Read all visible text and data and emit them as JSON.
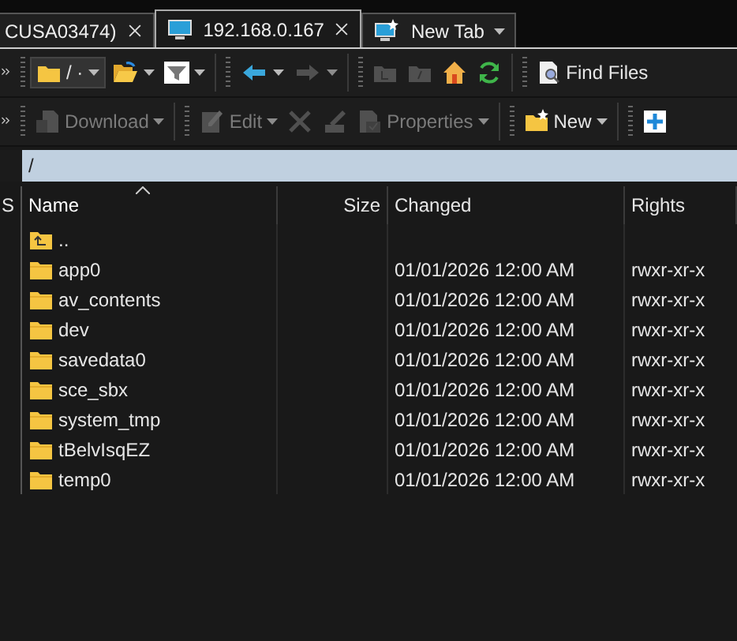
{
  "tabs": [
    {
      "label": "CUSA03474)",
      "kind": "session",
      "selected": false
    },
    {
      "label": "192.168.0.167",
      "kind": "session",
      "selected": true
    },
    {
      "label": "New Tab",
      "kind": "new",
      "selected": false
    }
  ],
  "toolbars": [
    [
      {
        "kind": "combo",
        "label": "/ ·",
        "caret": true,
        "disabled": false
      },
      {
        "kind": "icon",
        "caret": true,
        "disabled": false
      },
      {
        "kind": "icon",
        "caret": true,
        "disabled": false
      },
      {
        "kind": "separator"
      },
      {
        "kind": "icon",
        "caret": true,
        "disabled": false
      },
      {
        "kind": "icon",
        "caret": true,
        "disabled": true
      },
      {
        "kind": "separator"
      },
      {
        "kind": "icon",
        "caret": false,
        "disabled": true
      },
      {
        "kind": "icon",
        "caret": false,
        "disabled": true
      },
      {
        "kind": "icon",
        "caret": false,
        "disabled": false
      },
      {
        "kind": "icon",
        "caret": false,
        "disabled": false
      },
      {
        "kind": "separator"
      },
      {
        "kind": "button",
        "label": "Find Files",
        "caret": false,
        "disabled": false
      }
    ],
    [
      {
        "kind": "button",
        "label": "Download",
        "caret": true,
        "disabled": true
      },
      {
        "kind": "separator"
      },
      {
        "kind": "button",
        "label": "Edit",
        "caret": true,
        "disabled": true
      },
      {
        "kind": "icon",
        "caret": false,
        "disabled": true
      },
      {
        "kind": "icon",
        "caret": false,
        "disabled": true
      },
      {
        "kind": "button",
        "label": "Properties",
        "caret": true,
        "disabled": true
      },
      {
        "kind": "separator"
      },
      {
        "kind": "button",
        "label": "New",
        "caret": true,
        "disabled": false
      },
      {
        "kind": "separator"
      },
      {
        "kind": "icon",
        "caret": false,
        "disabled": false
      }
    ]
  ],
  "path": "/",
  "columns": [
    {
      "label": "S",
      "sorted": false
    },
    {
      "label": "Name",
      "sorted": true
    },
    {
      "label": "Size",
      "sorted": false
    },
    {
      "label": "Changed",
      "sorted": false
    },
    {
      "label": "Rights",
      "sorted": false
    }
  ],
  "rows": [
    {
      "kind": "parent",
      "name": "..",
      "changed": "",
      "rights": ""
    },
    {
      "kind": "folder",
      "name": "app0",
      "changed": "01/01/2026 12:00 AM",
      "rights": "rwxr-xr-x"
    },
    {
      "kind": "folder",
      "name": "av_contents",
      "changed": "01/01/2026 12:00 AM",
      "rights": "rwxr-xr-x"
    },
    {
      "kind": "folder",
      "name": "dev",
      "changed": "01/01/2026 12:00 AM",
      "rights": "rwxr-xr-x"
    },
    {
      "kind": "folder",
      "name": "savedata0",
      "changed": "01/01/2026 12:00 AM",
      "rights": "rwxr-xr-x"
    },
    {
      "kind": "folder",
      "name": "sce_sbx",
      "changed": "01/01/2026 12:00 AM",
      "rights": "rwxr-xr-x"
    },
    {
      "kind": "folder",
      "name": "system_tmp",
      "changed": "01/01/2026 12:00 AM",
      "rights": "rwxr-xr-x"
    },
    {
      "kind": "folder",
      "name": "tBelvIsqEZ",
      "changed": "01/01/2026 12:00 AM",
      "rights": "rwxr-xr-x"
    },
    {
      "kind": "folder",
      "name": "temp0",
      "changed": "01/01/2026 12:00 AM",
      "rights": "rwxr-xr-x"
    }
  ]
}
